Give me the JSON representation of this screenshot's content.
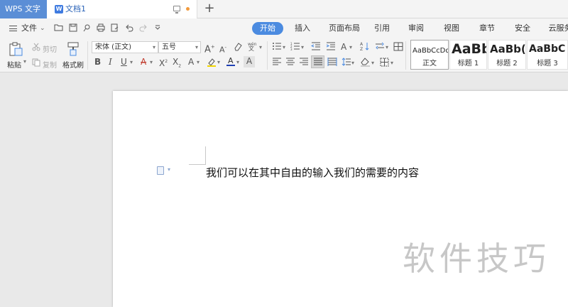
{
  "titlebar": {
    "app_name": "WPS 文字",
    "doc_tab": {
      "icon_letter": "W",
      "title": "文档1"
    },
    "new_tab_symbol": "+"
  },
  "menubar": {
    "file_label": "文件",
    "file_caret": "⌄",
    "quick_access_icons": [
      "open-folder-icon",
      "save-icon",
      "print-preview-icon",
      "print-icon",
      "export-icon",
      "undo-icon",
      "redo-icon",
      "customize-icon"
    ],
    "tabs": [
      {
        "label": "开始",
        "active": true
      },
      {
        "label": "插入",
        "active": false
      },
      {
        "label": "页面布局",
        "active": false
      },
      {
        "label": "引用",
        "active": false
      },
      {
        "label": "审阅",
        "active": false
      },
      {
        "label": "视图",
        "active": false
      },
      {
        "label": "章节",
        "active": false
      },
      {
        "label": "安全",
        "active": false
      },
      {
        "label": "云服务",
        "active": false
      }
    ]
  },
  "ribbon": {
    "paste_label": "粘贴",
    "cut_label": "剪切",
    "copy_label": "复制",
    "format_painter_label": "格式刷",
    "font_name": "宋体 (正文)",
    "font_size": "五号",
    "style_gallery": [
      {
        "sample": "AaBbCcDd",
        "name": "正文",
        "selected": true
      },
      {
        "sample": "AaBb",
        "name": "标题 1",
        "selected": false
      },
      {
        "sample": "AaBb(",
        "name": "标题 2",
        "selected": false
      },
      {
        "sample": "AaBbC",
        "name": "标题 3",
        "selected": false
      }
    ]
  },
  "document": {
    "body_text": "我们可以在其中自由的输入我们的需要的内容",
    "watermark": "软件技巧"
  },
  "colors": {
    "accent": "#4b8be0",
    "app_tab": "#5b8ed6",
    "font_color_bar": "#1f3fb3",
    "highlight_bar": "#f2d500"
  }
}
